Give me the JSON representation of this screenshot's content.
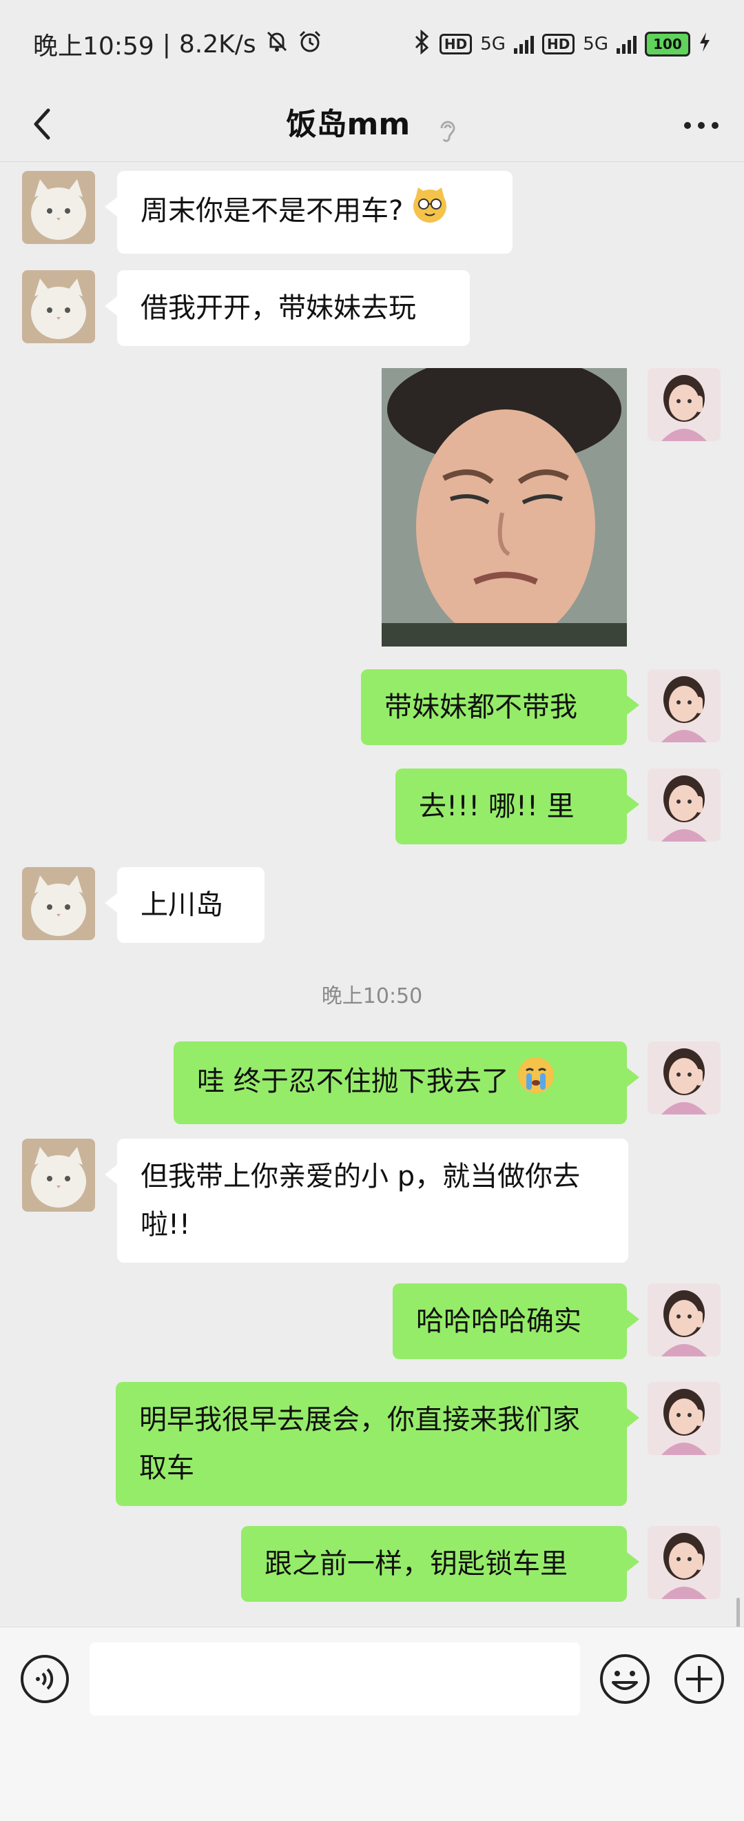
{
  "status_bar": {
    "time": "晚上10:59",
    "separator": "|",
    "net_speed": "8.2K/s",
    "hd1": "HD",
    "net1": "5G",
    "hd2": "HD",
    "net2": "5G",
    "battery": "100"
  },
  "header": {
    "title": "饭岛mm",
    "more_icon": "more-dots-icon",
    "back_icon": "back-chevron-icon"
  },
  "colors": {
    "background": "#ededed",
    "bubble_self": "#95ec69",
    "bubble_other": "#ffffff",
    "battery": "#5fd35b"
  },
  "messages": [
    {
      "side": "left",
      "type": "text",
      "text": "周末你是不是不用车?",
      "emoji": "cat-glasses-emoji"
    },
    {
      "side": "left",
      "type": "text",
      "text": "借我开开，带妹妹去玩"
    },
    {
      "side": "right",
      "type": "image",
      "image": "crying-man-meme"
    },
    {
      "side": "right",
      "type": "text",
      "text": "带妹妹都不带我"
    },
    {
      "side": "right",
      "type": "text",
      "text": "去!!! 哪!! 里"
    },
    {
      "side": "left",
      "type": "text",
      "text": "上川岛"
    },
    {
      "type": "timestamp",
      "text": "晚上10:50"
    },
    {
      "side": "right",
      "type": "text",
      "text": "哇  终于忍不住抛下我去了",
      "emoji": "crying-face-emoji"
    },
    {
      "side": "left",
      "type": "text",
      "text": "但我带上你亲爱的小 p，就当做你去啦!!"
    },
    {
      "side": "right",
      "type": "text",
      "text": "哈哈哈哈确实"
    },
    {
      "side": "right",
      "type": "text",
      "text": "明早我很早去展会，你直接来我们家取车"
    },
    {
      "side": "right",
      "type": "text",
      "text": "跟之前一样，钥匙锁车里"
    }
  ],
  "input_bar": {
    "voice_icon": "voice-icon",
    "emoji_icon": "smiley-icon",
    "plus_icon": "plus-icon",
    "value": ""
  }
}
